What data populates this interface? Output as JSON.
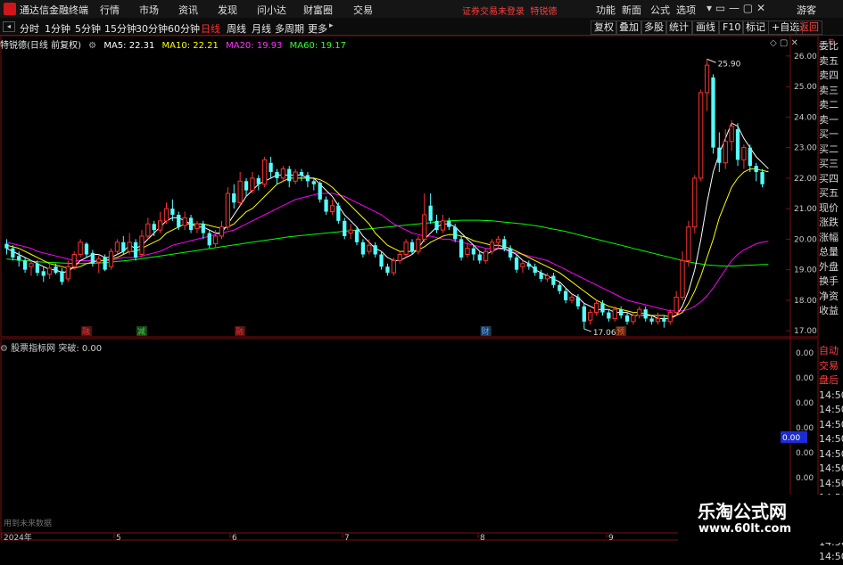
{
  "app": {
    "title": "通达信金融终端",
    "notice": "证券交易未登录",
    "account": "特锐德",
    "guest": "游客"
  },
  "menu": [
    "行情",
    "市场",
    "资讯",
    "发现",
    "问小达",
    "财富圈",
    "交易"
  ],
  "right_menu": [
    "功能",
    "新面",
    "公式",
    "选项"
  ],
  "periods": [
    "分时",
    "1分钟",
    "5分钟",
    "15分钟",
    "30分钟",
    "60分钟",
    "日线",
    "周线",
    "月线",
    "多周期",
    "更多"
  ],
  "active_period": "日线",
  "tools": [
    "复权",
    "叠加",
    "多股",
    "统计",
    "画线",
    "F10",
    "标记",
    "+自选",
    "返回"
  ],
  "stock_header": {
    "name": "特锐德(日线 前复权)",
    "ma5_label": "MA5: 22.31",
    "ma10_label": "MA10: 22.21",
    "ma20_label": "MA20: 19.93",
    "ma60_label": "MA60: 19.17"
  },
  "indicator_header": {
    "title": "股票指标网",
    "value_label": "突破: 0.00"
  },
  "main_axis": [
    "26.00",
    "25.00",
    "24.00",
    "23.00",
    "22.00",
    "21.00",
    "20.00",
    "19.00",
    "18.00",
    "17.00"
  ],
  "sub_axis": [
    "0.00",
    "0.00",
    "0.00",
    "0.00",
    "0.00",
    "0.00"
  ],
  "sub_axis_highlight": "0.00",
  "x_labels": [
    "2024年",
    "5",
    "6",
    "7",
    "8",
    "9"
  ],
  "annotations": {
    "high": "25.90",
    "low": "17.06"
  },
  "markers": [
    "融",
    "减",
    "融",
    "财",
    "预"
  ],
  "side_panel": [
    "委比",
    "卖五",
    "卖四",
    "卖三",
    "卖二",
    "卖一",
    "买一",
    "买二",
    "买三",
    "买四",
    "买五",
    "现价",
    "涨跌",
    "涨幅",
    "总量",
    "外盘",
    "换手",
    "净资",
    "收益"
  ],
  "side_panel_lower": [
    "自动",
    "交易",
    "盘后",
    "14:50",
    "14:50",
    "14:50",
    "14:50",
    "14:50",
    "14:50",
    "14:50",
    "14:50",
    "14:50",
    "14:50",
    "14:50",
    "14:50"
  ],
  "footer_note": "用到未来数据",
  "watermark": {
    "title": "乐淘公式网",
    "url": "www.60lt.com"
  },
  "colors": {
    "up": "#ff3232",
    "down": "#54ffff",
    "ma5": "#ffffff",
    "ma10": "#ffff00",
    "ma20": "#ff00ff",
    "ma60": "#00ff00",
    "accent": "#d0161b",
    "frame": "#7a1010"
  },
  "chart_data": {
    "type": "candlestick",
    "ylim": [
      16.8,
      26.2
    ],
    "candles": [
      [
        19.85,
        19.7,
        20.0,
        19.5
      ],
      [
        19.7,
        19.4,
        19.8,
        19.3
      ],
      [
        19.45,
        19.3,
        19.6,
        19.1
      ],
      [
        19.3,
        19.0,
        19.4,
        18.9
      ],
      [
        19.1,
        19.2,
        19.3,
        18.8
      ],
      [
        19.2,
        18.9,
        19.3,
        18.8
      ],
      [
        18.95,
        18.8,
        19.1,
        18.6
      ],
      [
        18.85,
        19.05,
        19.2,
        18.7
      ],
      [
        19.1,
        18.9,
        19.2,
        18.85
      ],
      [
        18.95,
        18.6,
        19.05,
        18.5
      ],
      [
        18.7,
        19.1,
        19.3,
        18.6
      ],
      [
        19.1,
        19.5,
        19.6,
        19.0
      ],
      [
        19.5,
        19.9,
        20.0,
        19.4
      ],
      [
        19.85,
        19.5,
        19.9,
        19.4
      ],
      [
        19.55,
        19.2,
        19.65,
        19.1
      ],
      [
        19.25,
        19.35,
        19.5,
        18.9
      ],
      [
        19.4,
        19.0,
        19.5,
        18.95
      ],
      [
        19.1,
        19.6,
        19.7,
        19.0
      ],
      [
        19.6,
        19.9,
        20.0,
        19.5
      ],
      [
        19.9,
        19.6,
        20.1,
        19.5
      ],
      [
        19.6,
        19.9,
        20.2,
        19.5
      ],
      [
        19.9,
        19.4,
        20.0,
        19.3
      ],
      [
        19.5,
        20.1,
        20.3,
        19.4
      ],
      [
        20.1,
        20.5,
        20.7,
        20.0
      ],
      [
        20.5,
        20.3,
        20.6,
        20.1
      ],
      [
        20.3,
        20.6,
        20.9,
        20.2
      ],
      [
        20.6,
        21.0,
        21.2,
        20.5
      ],
      [
        21.0,
        20.8,
        21.3,
        20.6
      ],
      [
        20.8,
        20.4,
        20.9,
        20.3
      ],
      [
        20.45,
        20.7,
        20.9,
        20.3
      ],
      [
        20.7,
        20.3,
        20.8,
        20.2
      ],
      [
        20.35,
        20.5,
        20.6,
        20.2
      ],
      [
        20.5,
        20.2,
        20.6,
        20.0
      ],
      [
        20.2,
        19.8,
        20.3,
        19.7
      ],
      [
        19.85,
        20.1,
        20.3,
        19.7
      ],
      [
        20.1,
        20.4,
        20.6,
        20.0
      ],
      [
        20.4,
        21.5,
        21.7,
        20.3
      ],
      [
        21.5,
        21.2,
        21.8,
        21.0
      ],
      [
        21.2,
        21.9,
        22.2,
        21.1
      ],
      [
        21.9,
        21.6,
        22.0,
        21.4
      ],
      [
        21.6,
        22.0,
        22.2,
        21.5
      ],
      [
        22.0,
        21.8,
        22.1,
        21.6
      ],
      [
        21.8,
        22.6,
        22.7,
        21.7
      ],
      [
        22.5,
        22.2,
        22.7,
        22.0
      ],
      [
        22.2,
        22.0,
        22.3,
        21.8
      ],
      [
        22.0,
        22.3,
        22.4,
        21.9
      ],
      [
        22.3,
        21.9,
        22.4,
        21.7
      ],
      [
        21.9,
        22.2,
        22.3,
        21.8
      ],
      [
        22.2,
        22.1,
        22.3,
        21.9
      ],
      [
        22.1,
        21.9,
        22.2,
        21.7
      ],
      [
        21.9,
        21.8,
        22.0,
        21.6
      ],
      [
        21.85,
        21.3,
        21.9,
        21.2
      ],
      [
        21.3,
        20.9,
        21.4,
        20.8
      ],
      [
        20.9,
        21.1,
        21.3,
        20.8
      ],
      [
        21.1,
        20.6,
        21.2,
        20.5
      ],
      [
        20.6,
        20.1,
        20.7,
        20.0
      ],
      [
        20.2,
        20.3,
        20.5,
        20.0
      ],
      [
        20.3,
        19.9,
        20.4,
        19.8
      ],
      [
        19.9,
        19.5,
        20.0,
        19.4
      ],
      [
        19.6,
        19.8,
        20.0,
        19.5
      ],
      [
        19.8,
        19.5,
        19.9,
        19.4
      ],
      [
        19.5,
        19.1,
        19.6,
        19.0
      ],
      [
        19.1,
        18.9,
        19.2,
        18.8
      ],
      [
        18.9,
        19.3,
        19.4,
        18.8
      ],
      [
        19.3,
        19.5,
        19.6,
        19.2
      ],
      [
        19.5,
        19.9,
        20.0,
        19.4
      ],
      [
        19.9,
        19.6,
        20.0,
        19.5
      ],
      [
        19.6,
        20.0,
        20.1,
        19.5
      ],
      [
        20.0,
        20.8,
        21.5,
        19.9
      ],
      [
        21.1,
        20.6,
        21.5,
        20.5
      ],
      [
        20.6,
        20.3,
        20.8,
        20.2
      ],
      [
        20.3,
        20.6,
        20.8,
        20.2
      ],
      [
        20.6,
        20.4,
        20.7,
        20.3
      ],
      [
        20.4,
        20.0,
        20.5,
        19.9
      ],
      [
        20.0,
        19.4,
        20.1,
        19.3
      ],
      [
        19.5,
        19.7,
        19.9,
        19.4
      ],
      [
        19.7,
        19.5,
        19.8,
        19.3
      ],
      [
        19.5,
        19.3,
        19.6,
        19.2
      ],
      [
        19.3,
        19.6,
        19.7,
        19.2
      ],
      [
        19.6,
        19.9,
        20.0,
        19.5
      ],
      [
        19.9,
        20.0,
        20.1,
        19.7
      ],
      [
        20.0,
        19.7,
        20.1,
        19.6
      ],
      [
        19.7,
        19.4,
        19.8,
        19.3
      ],
      [
        19.4,
        19.0,
        19.5,
        18.9
      ],
      [
        19.1,
        19.2,
        19.3,
        18.9
      ],
      [
        19.2,
        19.1,
        19.3,
        19.0
      ],
      [
        19.1,
        18.9,
        19.2,
        18.8
      ],
      [
        18.9,
        18.7,
        19.0,
        18.6
      ],
      [
        18.7,
        18.8,
        18.9,
        18.6
      ],
      [
        18.8,
        18.5,
        18.9,
        18.4
      ],
      [
        18.5,
        18.3,
        18.6,
        18.2
      ],
      [
        18.3,
        18.0,
        18.4,
        17.9
      ],
      [
        18.0,
        18.1,
        18.2,
        17.9
      ],
      [
        18.1,
        17.8,
        18.2,
        17.7
      ],
      [
        17.8,
        17.3,
        17.9,
        17.06
      ],
      [
        17.35,
        17.6,
        17.7,
        17.2
      ],
      [
        17.6,
        17.9,
        18.0,
        17.5
      ],
      [
        17.9,
        17.6,
        18.0,
        17.5
      ],
      [
        17.6,
        17.4,
        17.7,
        17.3
      ],
      [
        17.4,
        17.7,
        17.8,
        17.3
      ],
      [
        17.7,
        17.5,
        17.8,
        17.4
      ],
      [
        17.5,
        17.3,
        17.6,
        17.2
      ],
      [
        17.3,
        17.5,
        17.6,
        17.2
      ],
      [
        17.5,
        17.7,
        17.8,
        17.4
      ],
      [
        17.7,
        17.4,
        17.8,
        17.3
      ],
      [
        17.4,
        17.3,
        17.5,
        17.2
      ],
      [
        17.3,
        17.4,
        17.6,
        17.2
      ],
      [
        17.4,
        17.3,
        17.5,
        17.1
      ],
      [
        17.3,
        17.6,
        17.7,
        17.2
      ],
      [
        17.6,
        18.1,
        18.3,
        17.5
      ],
      [
        18.1,
        19.3,
        19.6,
        18.0
      ],
      [
        19.3,
        20.4,
        20.6,
        19.1
      ],
      [
        20.4,
        22.0,
        22.1,
        20.2
      ],
      [
        22.0,
        24.8,
        24.9,
        21.9
      ],
      [
        24.8,
        25.7,
        25.9,
        24.2
      ],
      [
        25.3,
        23.0,
        25.4,
        22.8
      ],
      [
        23.0,
        22.5,
        23.5,
        22.2
      ],
      [
        22.5,
        23.2,
        23.6,
        22.3
      ],
      [
        23.2,
        23.7,
        23.9,
        22.9
      ],
      [
        23.6,
        22.6,
        23.8,
        22.4
      ],
      [
        22.6,
        23.0,
        23.1,
        22.3
      ],
      [
        23.0,
        22.4,
        23.1,
        22.2
      ],
      [
        22.4,
        22.2,
        22.5,
        21.9
      ],
      [
        22.2,
        21.8,
        22.3,
        21.7
      ]
    ],
    "ma5": [
      19.7,
      19.6,
      19.5,
      19.4,
      19.3,
      19.2,
      19.1,
      19.0,
      19.0,
      18.9,
      18.95,
      19.1,
      19.3,
      19.4,
      19.5,
      19.5,
      19.4,
      19.4,
      19.5,
      19.6,
      19.8,
      19.7,
      19.8,
      20.0,
      20.2,
      20.4,
      20.6,
      20.7,
      20.7,
      20.6,
      20.5,
      20.4,
      20.4,
      20.3,
      20.2,
      20.2,
      20.5,
      20.8,
      21.1,
      21.4,
      21.6,
      21.8,
      21.9,
      22.0,
      22.1,
      22.1,
      22.1,
      22.1,
      22.1,
      22.0,
      22.0,
      21.8,
      21.6,
      21.4,
      21.1,
      20.8,
      20.6,
      20.4,
      20.1,
      19.9,
      19.7,
      19.6,
      19.4,
      19.3,
      19.3,
      19.4,
      19.5,
      19.7,
      20.0,
      20.2,
      20.4,
      20.5,
      20.5,
      20.4,
      20.2,
      20.0,
      19.8,
      19.6,
      19.5,
      19.6,
      19.7,
      19.7,
      19.6,
      19.5,
      19.3,
      19.2,
      19.0,
      18.9,
      18.8,
      18.7,
      18.6,
      18.4,
      18.2,
      18.1,
      17.9,
      17.8,
      17.7,
      17.7,
      17.7,
      17.6,
      17.6,
      17.6,
      17.5,
      17.5,
      17.5,
      17.5,
      17.4,
      17.4,
      17.4,
      17.5,
      17.8,
      18.3,
      19.0,
      20.0,
      21.2,
      22.2,
      22.8,
      23.3,
      23.8,
      23.7,
      23.3,
      23.0,
      22.7,
      22.5,
      22.31
    ],
    "ma10": [
      19.8,
      19.75,
      19.7,
      19.6,
      19.5,
      19.4,
      19.3,
      19.2,
      19.15,
      19.1,
      19.05,
      19.05,
      19.1,
      19.2,
      19.25,
      19.3,
      19.3,
      19.35,
      19.4,
      19.5,
      19.6,
      19.6,
      19.7,
      19.8,
      19.9,
      20.0,
      20.2,
      20.3,
      20.4,
      20.5,
      20.5,
      20.5,
      20.5,
      20.45,
      20.4,
      20.35,
      20.4,
      20.5,
      20.7,
      20.9,
      21.0,
      21.2,
      21.4,
      21.6,
      21.8,
      21.9,
      22.0,
      22.0,
      22.0,
      22.0,
      22.0,
      21.95,
      21.85,
      21.7,
      21.5,
      21.3,
      21.1,
      20.9,
      20.7,
      20.5,
      20.2,
      20.0,
      19.8,
      19.7,
      19.6,
      19.6,
      19.6,
      19.65,
      19.75,
      19.9,
      20.0,
      20.1,
      20.15,
      20.15,
      20.1,
      20.05,
      19.95,
      19.9,
      19.85,
      19.8,
      19.8,
      19.75,
      19.7,
      19.6,
      19.5,
      19.4,
      19.3,
      19.2,
      19.1,
      19.0,
      18.9,
      18.75,
      18.6,
      18.45,
      18.3,
      18.15,
      18.0,
      17.9,
      17.8,
      17.75,
      17.7,
      17.65,
      17.6,
      17.6,
      17.55,
      17.5,
      17.5,
      17.5,
      17.45,
      17.5,
      17.6,
      17.9,
      18.3,
      18.8,
      19.4,
      20.0,
      20.7,
      21.2,
      21.7,
      22.0,
      22.2,
      22.3,
      22.3,
      22.25,
      22.21
    ],
    "ma20": [
      19.9,
      19.85,
      19.8,
      19.75,
      19.7,
      19.6,
      19.55,
      19.5,
      19.45,
      19.4,
      19.35,
      19.3,
      19.3,
      19.3,
      19.3,
      19.3,
      19.3,
      19.3,
      19.35,
      19.4,
      19.4,
      19.4,
      19.45,
      19.5,
      19.55,
      19.6,
      19.7,
      19.8,
      19.85,
      19.9,
      19.95,
      20.0,
      20.05,
      20.1,
      20.15,
      20.2,
      20.25,
      20.3,
      20.4,
      20.5,
      20.6,
      20.7,
      20.8,
      20.9,
      21.0,
      21.1,
      21.2,
      21.3,
      21.35,
      21.4,
      21.45,
      21.5,
      21.5,
      21.5,
      21.45,
      21.4,
      21.3,
      21.2,
      21.1,
      21.0,
      20.9,
      20.8,
      20.65,
      20.5,
      20.4,
      20.3,
      20.2,
      20.15,
      20.1,
      20.1,
      20.05,
      20.0,
      20.0,
      19.95,
      19.9,
      19.85,
      19.8,
      19.75,
      19.7,
      19.7,
      19.7,
      19.65,
      19.6,
      19.55,
      19.5,
      19.45,
      19.4,
      19.35,
      19.3,
      19.2,
      19.1,
      19.0,
      18.9,
      18.8,
      18.7,
      18.6,
      18.5,
      18.4,
      18.3,
      18.2,
      18.1,
      18.0,
      17.95,
      17.9,
      17.85,
      17.8,
      17.75,
      17.7,
      17.65,
      17.65,
      17.65,
      17.7,
      17.8,
      17.95,
      18.15,
      18.4,
      18.7,
      19.0,
      19.3,
      19.5,
      19.65,
      19.75,
      19.85,
      19.9,
      19.93
    ],
    "ma60": [
      19.35,
      19.33,
      19.31,
      19.3,
      19.28,
      19.26,
      19.25,
      19.24,
      19.23,
      19.22,
      19.21,
      19.2,
      19.2,
      19.2,
      19.21,
      19.22,
      19.23,
      19.25,
      19.27,
      19.29,
      19.31,
      19.33,
      19.36,
      19.39,
      19.42,
      19.45,
      19.48,
      19.51,
      19.54,
      19.57,
      19.6,
      19.63,
      19.66,
      19.69,
      19.72,
      19.75,
      19.78,
      19.81,
      19.84,
      19.87,
      19.9,
      19.93,
      19.96,
      19.99,
      20.02,
      20.05,
      20.08,
      20.1,
      20.12,
      20.14,
      20.16,
      20.18,
      20.2,
      20.22,
      20.24,
      20.26,
      20.28,
      20.3,
      20.32,
      20.34,
      20.36,
      20.38,
      20.4,
      20.42,
      20.44,
      20.46,
      20.48,
      20.5,
      20.52,
      20.54,
      20.56,
      20.58,
      20.6,
      20.61,
      20.62,
      20.62,
      20.62,
      20.62,
      20.61,
      20.6,
      20.58,
      20.56,
      20.54,
      20.52,
      20.5,
      20.47,
      20.44,
      20.41,
      20.37,
      20.33,
      20.29,
      20.25,
      20.2,
      20.15,
      20.1,
      20.05,
      20.0,
      19.95,
      19.9,
      19.85,
      19.8,
      19.75,
      19.7,
      19.65,
      19.6,
      19.55,
      19.5,
      19.45,
      19.4,
      19.35,
      19.3,
      19.26,
      19.22,
      19.19,
      19.16,
      19.14,
      19.13,
      19.12,
      19.12,
      19.13,
      19.14,
      19.15,
      19.16,
      19.17,
      19.17
    ]
  }
}
